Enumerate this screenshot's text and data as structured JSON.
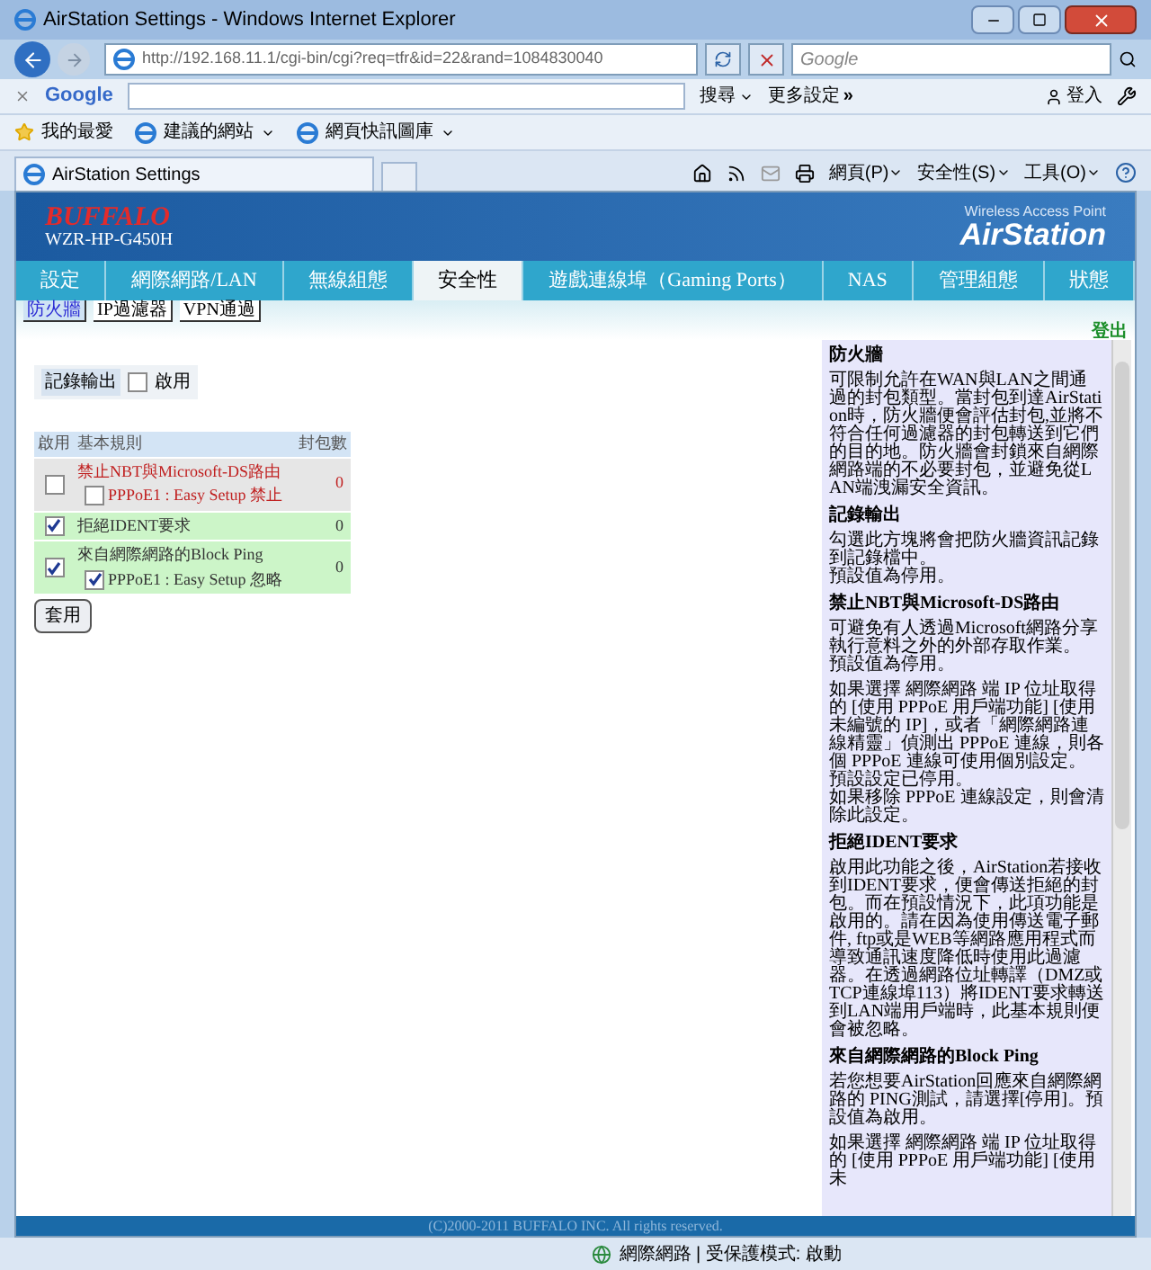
{
  "window": {
    "title": "AirStation Settings - Windows Internet Explorer"
  },
  "address_bar": {
    "url": "http://192.168.11.1/cgi-bin/cgi?req=tfr&id=22&rand=1084830040",
    "search_placeholder": "Google"
  },
  "google_toolbar": {
    "logo": "Google",
    "search_button": "搜尋",
    "more": "更多設定",
    "more_arrows": "»",
    "sign_in": "登入"
  },
  "favorites_bar": [
    {
      "label": "我的最愛"
    },
    {
      "label": "建議的網站"
    },
    {
      "label": "網頁快訊圖庫"
    }
  ],
  "browser_tab": {
    "title": "AirStation Settings"
  },
  "command_bar": [
    {
      "label": "網頁(P)"
    },
    {
      "label": "安全性(S)"
    },
    {
      "label": "工具(O)"
    }
  ],
  "header": {
    "brand": "BUFFALO",
    "model": "WZR-HP-G450H",
    "subtitle": "Wireless Access Point",
    "product": "AirStation"
  },
  "nav_tabs": [
    {
      "label": "設定",
      "selected": false
    },
    {
      "label": "網際網路/LAN",
      "selected": false
    },
    {
      "label": "無線組態",
      "selected": false
    },
    {
      "label": "安全性",
      "selected": true
    },
    {
      "label": "遊戲連線埠（Gaming Ports）",
      "selected": false
    },
    {
      "label": "NAS",
      "selected": false
    },
    {
      "label": "管理組態",
      "selected": false
    },
    {
      "label": "狀態",
      "selected": false
    }
  ],
  "sub_tabs": [
    {
      "label": "防火牆",
      "selected": true
    },
    {
      "label": "IP過濾器",
      "selected": false
    },
    {
      "label": "VPN通過",
      "selected": false
    }
  ],
  "logout": "登出",
  "log_output": {
    "label": "記錄輸出",
    "checkbox_label": "啟用",
    "checked": false
  },
  "rules_table": {
    "columns": [
      "啟用",
      "基本規則",
      "封包數"
    ],
    "rows": [
      {
        "enabled": false,
        "rule": "禁止NBT與Microsoft-DS路由",
        "sub_option": {
          "label": "PPPoE1 : Easy Setup 禁止",
          "checked": false
        },
        "packets": "0"
      },
      {
        "enabled": true,
        "rule": "拒絕IDENT要求",
        "packets": "0"
      },
      {
        "enabled": true,
        "rule": "來自網際網路的Block Ping",
        "sub_option": {
          "label": "PPPoE1 : Easy Setup 忽略",
          "checked": true
        },
        "packets": "0"
      }
    ]
  },
  "apply_button": "套用",
  "help": [
    {
      "kind": "heading",
      "text": "防火牆"
    },
    {
      "kind": "paragraph",
      "lines": [
        "可限制允許在WAN與LAN之間通過的封包類型。當封包到達AirStation時，防火牆便會評估封包,並將不符合任何過濾器的封包轉送到它們的目的地。防火牆會封鎖來自網際網路端的不必要封包，並避免從LAN端洩漏安全資訊。"
      ]
    },
    {
      "kind": "heading",
      "text": "記錄輸出"
    },
    {
      "kind": "paragraph",
      "lines": [
        "勾選此方塊將會把防火牆資訊記錄到記錄檔中。",
        "預設值為停用。"
      ]
    },
    {
      "kind": "heading",
      "text": "禁止NBT與Microsoft-DS路由"
    },
    {
      "kind": "paragraph",
      "lines": [
        "可避免有人透過Microsoft網路分享執行意料之外的外部存取作業。",
        "預設值為停用。"
      ]
    },
    {
      "kind": "paragraph",
      "lines": [
        "如果選擇 網際網路 端 IP 位址取得的 [使用 PPPoE 用戶端功能] [使用未編號的 IP]，或者「網際網路連線精靈」偵測出 PPPoE 連線，則各個 PPPoE 連線可使用個別設定。",
        "預設設定已停用。",
        "如果移除 PPPoE 連線設定，則會清除此設定。"
      ]
    },
    {
      "kind": "heading",
      "text": "拒絕IDENT要求"
    },
    {
      "kind": "paragraph",
      "lines": [
        "啟用此功能之後，AirStation若接收到IDENT要求，便會傳送拒絕的封包。而在預設情況下，此項功能是啟用的。請在因為使用傳送電子郵件, ftp或是WEB等網路應用程式而導致通訊速度降低時使用此過濾器。在透過網路位址轉譯（DMZ或TCP連線埠113）將IDENT要求轉送到LAN端用戶端時，此基本規則便會被忽略。"
      ]
    },
    {
      "kind": "heading",
      "text": "來自網際網路的Block Ping"
    },
    {
      "kind": "paragraph",
      "lines": [
        "若您想要AirStation回應來自網際網路的 PING測試，請選擇[停用]。預設值為啟用。"
      ]
    },
    {
      "kind": "paragraph",
      "lines": [
        "如果選擇 網際網路 端 IP 位址取得的 [使用 PPPoE 用戶端功能] [使用未"
      ]
    }
  ],
  "footer": "(C)2000-2011 BUFFALO INC. All rights reserved.",
  "status_bar": {
    "zone": "網際網路 | 受保護模式: 啟動"
  }
}
